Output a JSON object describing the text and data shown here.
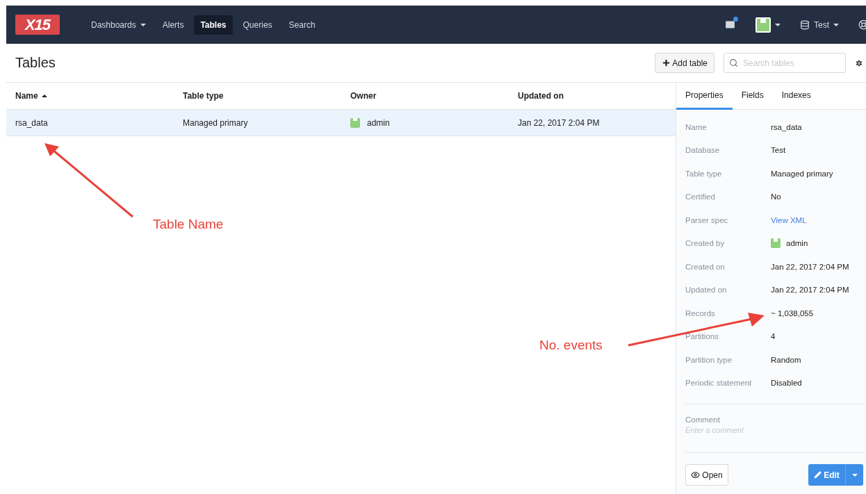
{
  "nav": {
    "logo": "X15",
    "items": [
      {
        "label": "Dashboards",
        "dropdown": true,
        "selected": false
      },
      {
        "label": "Alerts",
        "dropdown": false,
        "selected": false
      },
      {
        "label": "Tables",
        "dropdown": false,
        "selected": true
      },
      {
        "label": "Queries",
        "dropdown": false,
        "selected": false
      },
      {
        "label": "Search",
        "dropdown": false,
        "selected": false
      }
    ],
    "unread_messages": true,
    "database": "Test"
  },
  "page": {
    "title": "Tables",
    "add_button": "Add table",
    "search": {
      "placeholder": "Search tables"
    }
  },
  "table": {
    "columns": [
      {
        "label": "Name",
        "sorted": true
      },
      {
        "label": "Table type",
        "sorted": false
      },
      {
        "label": "Owner",
        "sorted": false
      },
      {
        "label": "Updated on",
        "sorted": false
      }
    ],
    "rows": [
      {
        "name": "rsa_data",
        "table_type": "Managed primary",
        "owner": "admin",
        "updated_on": "Jan 22, 2017 2:04 PM",
        "selected": true
      }
    ]
  },
  "panel": {
    "tabs": [
      {
        "label": "Properties",
        "selected": true
      },
      {
        "label": "Fields",
        "selected": false
      },
      {
        "label": "Indexes",
        "selected": false
      }
    ],
    "properties": [
      {
        "label": "Name",
        "value": "rsa_data",
        "kind": "text"
      },
      {
        "label": "Database",
        "value": "Test",
        "kind": "text"
      },
      {
        "label": "Table type",
        "value": "Managed primary",
        "kind": "text"
      },
      {
        "label": "Certified",
        "value": "No",
        "kind": "text"
      },
      {
        "label": "Parser spec",
        "value": "View XML",
        "kind": "link"
      },
      {
        "label": "Created by",
        "value": "admin",
        "kind": "user"
      },
      {
        "label": "Created on",
        "value": "Jan 22, 2017 2:04 PM",
        "kind": "text"
      },
      {
        "label": "Updated on",
        "value": "Jan 22, 2017 2:04 PM",
        "kind": "text"
      },
      {
        "label": "Records",
        "value": "~ 1,038,055",
        "kind": "text"
      },
      {
        "label": "Partitions",
        "value": "4",
        "kind": "text"
      },
      {
        "label": "Partition type",
        "value": "Random",
        "kind": "text"
      },
      {
        "label": "Periodic statement",
        "value": "Disabled",
        "kind": "text"
      }
    ],
    "comment": {
      "label": "Comment",
      "placeholder": "Enter a comment"
    },
    "open_button": "Open",
    "edit_button": "Edit"
  },
  "annotations": [
    {
      "text": "Table Name"
    },
    {
      "text": "No. events"
    }
  ]
}
